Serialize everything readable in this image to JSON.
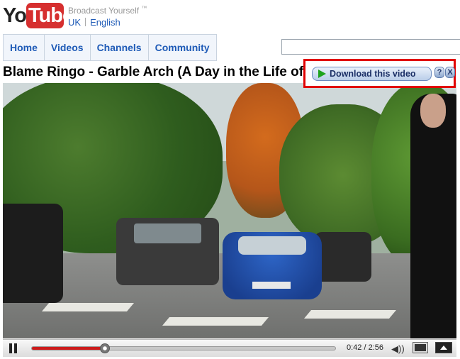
{
  "header": {
    "logo_you": "You",
    "logo_tube": "Tube",
    "tagline": "Broadcast Yourself",
    "tagline_mark": "™",
    "locale_country": "UK",
    "locale_language": "English"
  },
  "nav": {
    "items": [
      {
        "label": "Home"
      },
      {
        "label": "Videos"
      },
      {
        "label": "Channels"
      },
      {
        "label": "Community"
      }
    ],
    "search_value": ""
  },
  "video": {
    "title": "Blame Ringo - Garble Arch (A Day in the Life of",
    "current_time": "0:42",
    "duration": "2:56",
    "progress_fraction": 0.24
  },
  "download_overlay": {
    "button_label": "Download this video",
    "help_label": "?",
    "close_label": "X"
  },
  "colors": {
    "brand_red": "#d62f2f",
    "link_blue": "#1f5bb7",
    "highlight_border": "#e10000"
  }
}
